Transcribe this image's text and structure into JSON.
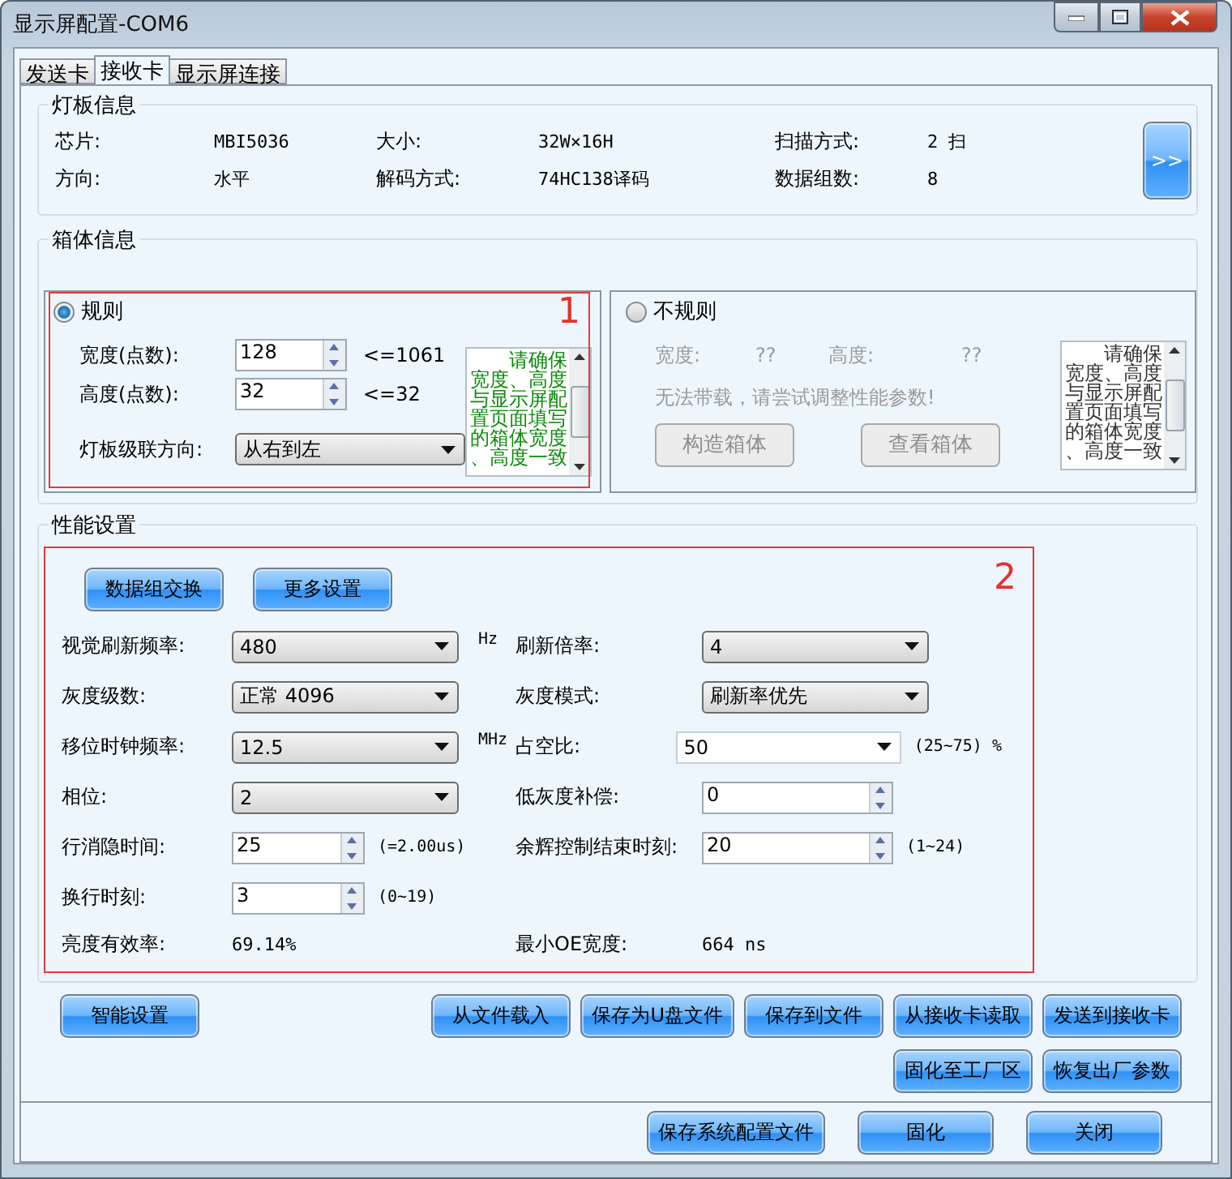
{
  "window": {
    "title": "显示屏配置-COM6"
  },
  "tabs": [
    {
      "label": "发送卡",
      "selected": false
    },
    {
      "label": "接收卡",
      "selected": true
    },
    {
      "label": "显示屏连接",
      "selected": false
    }
  ],
  "panel_info": {
    "title": "灯板信息",
    "more_button": ">>",
    "fields": [
      {
        "label": "芯片:",
        "value": "MBI5036"
      },
      {
        "label": "大小:",
        "value": "32W×16H"
      },
      {
        "label": "扫描方式:",
        "value": "2 扫"
      },
      {
        "label": "方向:",
        "value": "水平"
      },
      {
        "label": "解码方式:",
        "value": "74HC138译码"
      },
      {
        "label": "数据组数:",
        "value": "8"
      }
    ]
  },
  "cabinet_info": {
    "title": "箱体信息",
    "regular": {
      "label": "规则",
      "selected": true,
      "annotation": "1",
      "width": {
        "label": "宽度(点数):",
        "value": "128",
        "limit": "<=1061"
      },
      "height": {
        "label": "高度(点数):",
        "value": "32",
        "limit": "<=32"
      },
      "direction": {
        "label": "灯板级联方向:",
        "value": "从右到左"
      },
      "note": "请确保宽度、高度与显示屏配置页面填写的箱体宽度、高度一致"
    },
    "irregular": {
      "label": "不规则",
      "selected": false,
      "disabled": true,
      "width": {
        "label": "宽度:",
        "value": "??"
      },
      "height": {
        "label": "高度:",
        "value": "??"
      },
      "message": "无法带载，请尝试调整性能参数!",
      "buttons": [
        {
          "label": "构造箱体",
          "disabled": true
        },
        {
          "label": "查看箱体",
          "disabled": true
        }
      ],
      "note": "请确保宽度、高度与显示屏配置页面填写的箱体宽度、高度一致"
    }
  },
  "performance": {
    "title": "性能设置",
    "annotation": "2",
    "buttons": [
      "数据组交换",
      "更多设置"
    ],
    "rows": [
      {
        "left": {
          "kind": "select",
          "label": "视觉刷新频率:",
          "value": "480",
          "unit": "Hz"
        },
        "right": {
          "kind": "select",
          "label": "刷新倍率:",
          "value": "4"
        }
      },
      {
        "left": {
          "kind": "select",
          "label": "灰度级数:",
          "value": "正常 4096"
        },
        "right": {
          "kind": "select",
          "label": "灰度模式:",
          "value": "刷新率优先"
        }
      },
      {
        "left": {
          "kind": "select",
          "label": "移位时钟频率:",
          "value": "12.5",
          "unit": "MHz"
        },
        "right": {
          "kind": "combo",
          "label": "占空比:",
          "value": "50",
          "unit": "(25~75) %"
        }
      },
      {
        "left": {
          "kind": "select",
          "label": "相位:",
          "value": "2"
        },
        "right": {
          "kind": "spin",
          "label": "低灰度补偿:",
          "value": "0"
        }
      },
      {
        "left": {
          "kind": "spin",
          "label": "行消隐时间:",
          "value": "25",
          "unit": "(=2.00us)"
        },
        "right": {
          "kind": "spin",
          "label": "余辉控制结束时刻:",
          "value": "20",
          "unit": "(1~24)"
        }
      },
      {
        "left": {
          "kind": "spin",
          "label": "换行时刻:",
          "value": "3",
          "unit": "(0~19)"
        }
      },
      {
        "left": {
          "kind": "readout",
          "label": "亮度有效率:",
          "value": "69.14%"
        },
        "right": {
          "kind": "readout",
          "label": "最小OE宽度:",
          "value": "664 ns"
        }
      }
    ]
  },
  "smart_button": "智能设置",
  "action_buttons": [
    [
      "从文件载入",
      "保存为U盘文件",
      "保存到文件",
      "从接收卡读取",
      "发送到接收卡"
    ],
    [
      "固化至工厂区",
      "恢复出厂参数"
    ]
  ],
  "footer_buttons": [
    "保存系统配置文件",
    "固化",
    "关闭"
  ]
}
